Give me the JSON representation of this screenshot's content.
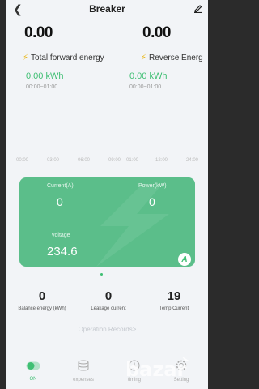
{
  "header": {
    "back_icon": "chevron-left-icon",
    "title": "Breaker",
    "edit_icon": "pencil-icon"
  },
  "summary": {
    "left": {
      "value": "0.00",
      "label": "Total forward energy",
      "kwh": "0.00 kWh",
      "range": "00:00~01:00"
    },
    "right": {
      "value": "0.00",
      "label": "Reverse Energ",
      "kwh": "0.00 kWh",
      "range": "00:00~01:00"
    }
  },
  "chart_axis": [
    "00:00",
    "03:00",
    "06:00",
    "09:00",
    "01:00",
    "12:00",
    "24:00"
  ],
  "card": {
    "current_label": "Current(A)",
    "current_value": "0",
    "power_label": "Power(kW)",
    "power_value": "0",
    "voltage_label": "voltage",
    "voltage_value": "234.6",
    "badge": "A",
    "color": "#5bbe8a"
  },
  "stats": [
    {
      "value": "0",
      "label": "Balance energy (kWh)"
    },
    {
      "value": "0",
      "label": "Leakage current"
    },
    {
      "value": "19",
      "label": "Temp Current"
    }
  ],
  "records_link": "Operation Records>",
  "nav": [
    {
      "label": "ON",
      "icon": "toggle-icon",
      "active": true
    },
    {
      "label": "expenses",
      "icon": "coins-icon",
      "active": false
    },
    {
      "label": "timing",
      "icon": "clock-icon",
      "active": false
    },
    {
      "label": "Setting",
      "icon": "gear-icon",
      "active": false
    }
  ],
  "watermark": "bazar",
  "accent": "#3fbf73"
}
